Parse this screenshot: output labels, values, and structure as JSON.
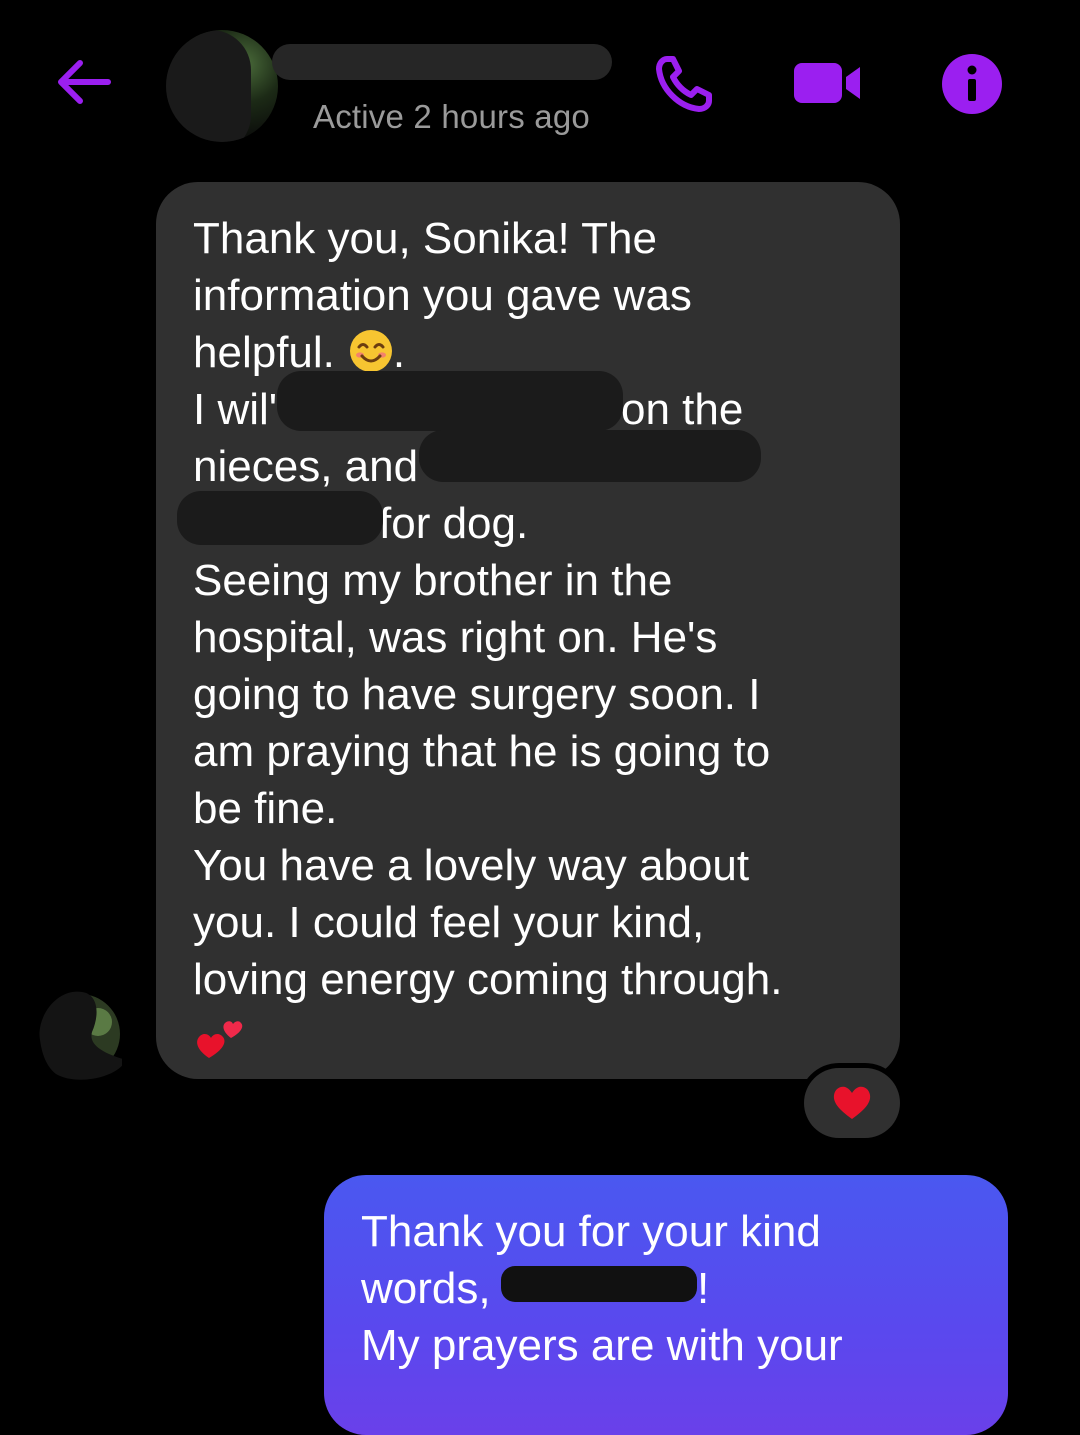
{
  "header": {
    "active_status": "Active 2 hours ago"
  },
  "icons": {
    "back": "arrow-left-icon",
    "call": "phone-icon",
    "video": "video-camera-icon",
    "info": "info-icon",
    "smile": "smiling-face-emoji",
    "hearts": "two-hearts-emoji",
    "reaction": "red-heart-emoji"
  },
  "colors": {
    "accent": "#9b1ff0",
    "incoming_bubble": "#303030",
    "outgoing_bubble": "#4f52ef",
    "status_text": "#9a9a9a",
    "heart": "#e8122b"
  },
  "incoming_message": {
    "lines": [
      "Thank you, Sonika! The",
      "information you gave was",
      "helpful.",
      "I wil'",
      "on the",
      "nieces, and",
      "for dog.",
      "Seeing my brother in the",
      "hospital, was right on. He's",
      "going to have surgery soon. I",
      "am praying that he is going to",
      "be fine.",
      "You have a lovely way about",
      "you. I could feel your kind,",
      "loving energy coming through."
    ],
    "after_emoji": "."
  },
  "outgoing_message": {
    "lines": [
      "Thank you for your kind",
      "words,",
      "!",
      "My prayers are with your"
    ]
  }
}
